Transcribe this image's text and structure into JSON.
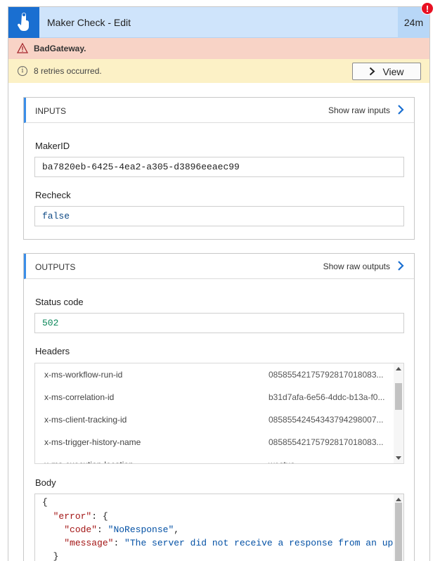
{
  "header": {
    "title": "Maker Check - Edit",
    "duration": "24m",
    "alert_glyph": "!",
    "icon": "touch-hand-icon",
    "accent_color": "#1a6fd1"
  },
  "error": {
    "text": "BadGateway."
  },
  "retry": {
    "text": "8 retries occurred.",
    "view_label": "View"
  },
  "inputs": {
    "title": "INPUTS",
    "raw_label": "Show raw inputs",
    "fields": [
      {
        "label": "MakerID",
        "value": "ba7820eb-6425-4ea2-a305-d3896eeaec99"
      },
      {
        "label": "Recheck",
        "value": "false"
      }
    ]
  },
  "outputs": {
    "title": "OUTPUTS",
    "raw_label": "Show raw outputs",
    "status_label": "Status code",
    "status_value": "502",
    "headers_label": "Headers",
    "headers": [
      {
        "key": "x-ms-workflow-run-id",
        "value": "08585542175792817018083..."
      },
      {
        "key": "x-ms-correlation-id",
        "value": "b31d7afa-6e56-4ddc-b13a-f0..."
      },
      {
        "key": "x-ms-client-tracking-id",
        "value": "08585542454343794298007..."
      },
      {
        "key": "x-ms-trigger-history-name",
        "value": "08585542175792817018083..."
      },
      {
        "key": "x-ms-execution-location",
        "value": "westus"
      }
    ],
    "body_label": "Body",
    "body": {
      "open": "{",
      "error_key": "\"error\"",
      "error_open": ": {",
      "code_key": "\"code\"",
      "code_value": "\"NoResponse\"",
      "message_key": "\"message\"",
      "message_value": "\"The server did not receive a response from an upstr",
      "close_inner": "}"
    }
  }
}
